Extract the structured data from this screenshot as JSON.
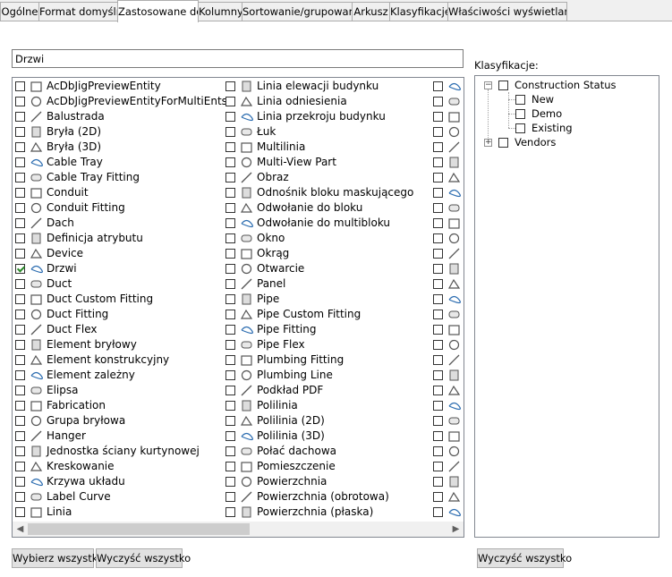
{
  "tabs": [
    {
      "label": "Ogólne",
      "active": false
    },
    {
      "label": "Format domyślny",
      "active": false
    },
    {
      "label": "Zastosowane do",
      "active": true
    },
    {
      "label": "Kolumny",
      "active": false
    },
    {
      "label": "Sortowanie/grupowanie",
      "active": false
    },
    {
      "label": "Arkusz",
      "active": false
    },
    {
      "label": "Klasyfikacje",
      "active": false
    },
    {
      "label": "Właściwości wyświetlania",
      "active": false
    }
  ],
  "filter": {
    "value": "Drzwi"
  },
  "object_list": {
    "column1": [
      {
        "label": "AcDbJigPreviewEntity",
        "checked": false,
        "icon": "brush-icon"
      },
      {
        "label": "AcDbJigPreviewEntityForMultiEnts",
        "checked": false,
        "icon": "brush-icon"
      },
      {
        "label": "Balustrada",
        "checked": false,
        "icon": "railing-icon"
      },
      {
        "label": "Bryła (2D)",
        "checked": false,
        "icon": "mass-2d-icon"
      },
      {
        "label": "Bryła (3D)",
        "checked": false,
        "icon": "mass-3d-icon"
      },
      {
        "label": "Cable Tray",
        "checked": false,
        "icon": "cable-tray-icon"
      },
      {
        "label": "Cable Tray Fitting",
        "checked": false,
        "icon": "cable-tray-fitting-icon"
      },
      {
        "label": "Conduit",
        "checked": false,
        "icon": "conduit-icon"
      },
      {
        "label": "Conduit Fitting",
        "checked": false,
        "icon": "conduit-fitting-icon"
      },
      {
        "label": "Dach",
        "checked": false,
        "icon": "roof-icon"
      },
      {
        "label": "Definicja atrybutu",
        "checked": false,
        "icon": "attribute-icon"
      },
      {
        "label": "Device",
        "checked": false,
        "icon": "device-icon"
      },
      {
        "label": "Drzwi",
        "checked": true,
        "icon": "door-icon"
      },
      {
        "label": "Duct",
        "checked": false,
        "icon": "duct-icon"
      },
      {
        "label": "Duct Custom Fitting",
        "checked": false,
        "icon": "duct-custom-fitting-icon"
      },
      {
        "label": "Duct Fitting",
        "checked": false,
        "icon": "duct-fitting-icon"
      },
      {
        "label": "Duct Flex",
        "checked": false,
        "icon": "duct-flex-icon"
      },
      {
        "label": "Element bryłowy",
        "checked": false,
        "icon": "mass-element-icon"
      },
      {
        "label": "Element konstrukcyjny",
        "checked": false,
        "icon": "structural-member-icon"
      },
      {
        "label": "Element zależny",
        "checked": false,
        "icon": "dependent-element-icon"
      },
      {
        "label": "Elipsa",
        "checked": false,
        "icon": "ellipse-icon"
      },
      {
        "label": "Fabrication",
        "checked": false,
        "icon": "fabrication-icon"
      },
      {
        "label": "Grupa bryłowa",
        "checked": false,
        "icon": "mass-group-icon"
      },
      {
        "label": "Hanger",
        "checked": false,
        "icon": "hanger-icon"
      },
      {
        "label": "Jednostka ściany kurtynowej",
        "checked": false,
        "icon": "curtain-wall-unit-icon"
      },
      {
        "label": "Kreskowanie",
        "checked": false,
        "icon": "hatch-icon"
      },
      {
        "label": "Krzywa układu",
        "checked": false,
        "icon": "layout-curve-icon"
      },
      {
        "label": "Label Curve",
        "checked": false,
        "icon": "label-curve-icon"
      },
      {
        "label": "Linia",
        "checked": false,
        "icon": "line-icon"
      }
    ],
    "column2": [
      {
        "label": "Linia elewacji budynku",
        "checked": false,
        "icon": "elevation-line-icon"
      },
      {
        "label": "Linia odniesienia",
        "checked": false,
        "icon": "leader-icon"
      },
      {
        "label": "Linia przekroju budynku",
        "checked": false,
        "icon": "section-line-icon"
      },
      {
        "label": "Łuk",
        "checked": false,
        "icon": "arc-icon"
      },
      {
        "label": "Multilinia",
        "checked": false,
        "icon": "multiline-icon"
      },
      {
        "label": "Multi-View Part",
        "checked": false,
        "icon": "multiview-part-icon"
      },
      {
        "label": "Obraz",
        "checked": false,
        "icon": "image-icon"
      },
      {
        "label": "Odnośnik bloku maskującego",
        "checked": false,
        "icon": "mask-block-icon"
      },
      {
        "label": "Odwołanie do bloku",
        "checked": false,
        "icon": "block-reference-icon"
      },
      {
        "label": "Odwołanie do multibloku",
        "checked": false,
        "icon": "multiblock-reference-icon"
      },
      {
        "label": "Okno",
        "checked": false,
        "icon": "window-icon"
      },
      {
        "label": "Okrąg",
        "checked": false,
        "icon": "circle-icon"
      },
      {
        "label": "Otwarcie",
        "checked": false,
        "icon": "opening-icon"
      },
      {
        "label": "Panel",
        "checked": false,
        "icon": "panel-icon"
      },
      {
        "label": "Pipe",
        "checked": false,
        "icon": "pipe-icon"
      },
      {
        "label": "Pipe Custom Fitting",
        "checked": false,
        "icon": "pipe-custom-fitting-icon"
      },
      {
        "label": "Pipe Fitting",
        "checked": false,
        "icon": "pipe-fitting-icon"
      },
      {
        "label": "Pipe Flex",
        "checked": false,
        "icon": "pipe-flex-icon"
      },
      {
        "label": "Plumbing Fitting",
        "checked": false,
        "icon": "plumbing-fitting-icon"
      },
      {
        "label": "Plumbing Line",
        "checked": false,
        "icon": "plumbing-line-icon"
      },
      {
        "label": "Podkład PDF",
        "checked": false,
        "icon": "pdf-underlay-icon"
      },
      {
        "label": "Polilinia",
        "checked": false,
        "icon": "polyline-icon"
      },
      {
        "label": "Polilinia (2D)",
        "checked": false,
        "icon": "polyline-2d-icon"
      },
      {
        "label": "Polilinia (3D)",
        "checked": false,
        "icon": "polyline-3d-icon"
      },
      {
        "label": "Połać dachowa",
        "checked": false,
        "icon": "roof-slab-icon"
      },
      {
        "label": "Pomieszczenie",
        "checked": false,
        "icon": "space-icon"
      },
      {
        "label": "Powierzchnia",
        "checked": false,
        "icon": "surface-icon"
      },
      {
        "label": "Powierzchnia (obrotowa)",
        "checked": false,
        "icon": "revolved-surface-icon"
      },
      {
        "label": "Powierzchnia (płaska)",
        "checked": false,
        "icon": "planar-surface-icon"
      }
    ],
    "column3_icons": [
      "column3-icon",
      "column3-icon",
      "column3-icon",
      "column3-icon",
      "column3-icon",
      "column3-icon",
      "column3-icon",
      "column3-icon",
      "column3-icon",
      "column3-icon",
      "column3-icon",
      "column3-icon",
      "column3-icon",
      "column3-icon",
      "column3-icon",
      "column3-icon",
      "column3-icon",
      "column3-icon",
      "column3-icon",
      "column3-icon",
      "column3-icon",
      "column3-icon",
      "column3-icon",
      "column3-icon",
      "column3-icon",
      "column3-icon",
      "column3-icon",
      "column3-icon",
      "column3-icon"
    ]
  },
  "classifications": {
    "label": "Klasyfikacje:",
    "tree": [
      {
        "label": "Construction Status",
        "expanded": true,
        "children": [
          "New",
          "Demo",
          "Existing"
        ]
      },
      {
        "label": "Vendors",
        "expanded": false,
        "children": []
      }
    ]
  },
  "buttons": {
    "select_all": "Wybierz wszystko",
    "clear_all": "Wyczyść wszystko",
    "clear_all_classifications": "Wyczyść wszystko"
  },
  "colors": {
    "check_mark": "#2a8a2a",
    "icon_blue": "#2b6cb0",
    "icon_gray": "#555555"
  }
}
